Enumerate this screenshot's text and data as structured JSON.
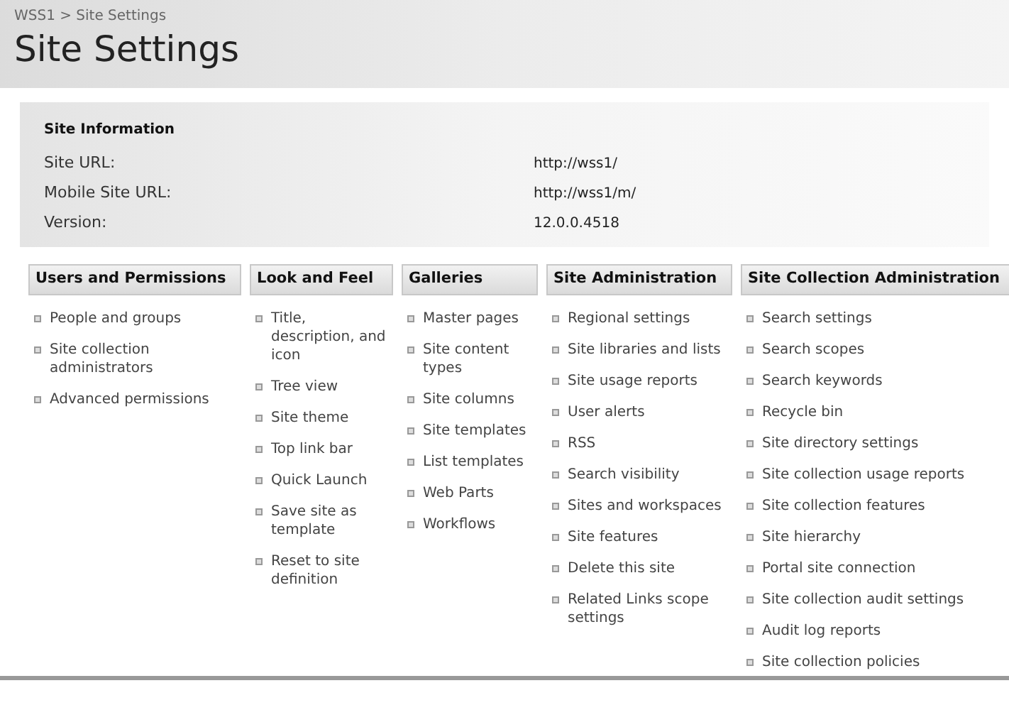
{
  "breadcrumb": "WSS1 > Site Settings",
  "title": "Site Settings",
  "site_information": {
    "heading": "Site Information",
    "rows": [
      {
        "label": "Site URL:",
        "value": "http://wss1/"
      },
      {
        "label": "Mobile Site URL:",
        "value": "http://wss1/m/"
      },
      {
        "label": "Version:",
        "value": "12.0.0.4518"
      }
    ]
  },
  "sections": [
    {
      "heading": "Users and Permissions",
      "links": [
        "People and groups",
        "Site collection administrators",
        "Advanced permissions"
      ]
    },
    {
      "heading": "Look and Feel",
      "links": [
        "Title, description, and icon",
        "Tree view",
        "Site theme",
        "Top link bar",
        "Quick Launch",
        "Save site as template",
        "Reset to site definition"
      ]
    },
    {
      "heading": "Galleries",
      "links": [
        "Master pages",
        "Site content types",
        "Site columns",
        "Site templates",
        "List templates",
        "Web Parts",
        "Workflows"
      ]
    },
    {
      "heading": "Site Administration",
      "links": [
        "Regional settings",
        "Site libraries and lists",
        "Site usage reports",
        "User alerts",
        "RSS",
        "Search visibility",
        "Sites and workspaces",
        "Site features",
        "Delete this site",
        "Related Links scope settings"
      ]
    },
    {
      "heading": "Site Collection Administration",
      "links": [
        "Search settings",
        "Search scopes",
        "Search keywords",
        "Recycle bin",
        "Site directory settings",
        "Site collection usage reports",
        "Site collection features",
        "Site hierarchy",
        "Portal site connection",
        "Site collection audit settings",
        "Audit log reports",
        "Site collection policies"
      ]
    }
  ]
}
